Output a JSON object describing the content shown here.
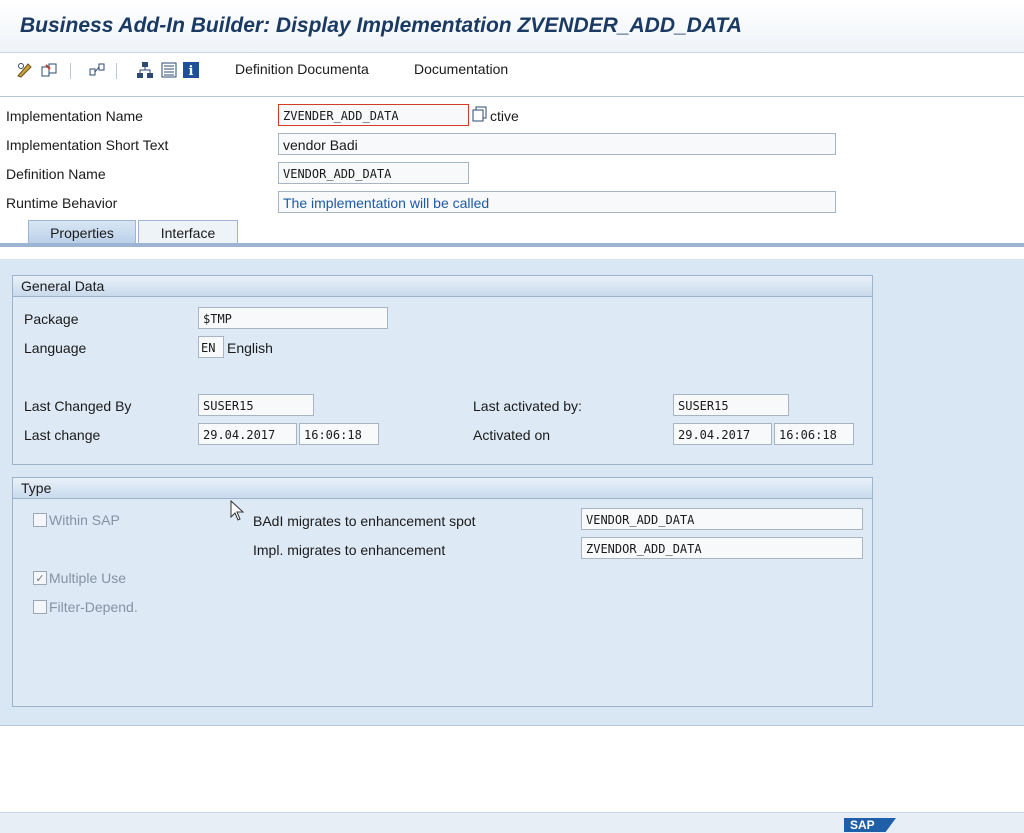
{
  "window": {
    "title": "Business Add-In Builder: Display Implementation ZVENDER_ADD_DATA"
  },
  "toolbar": {
    "icons": [
      "pencil-glasses-icon",
      "object-navigation-icon",
      "where-used-icon",
      "hierarchy-icon",
      "print-icon",
      "info-icon"
    ],
    "definition_doc_label": "Definition Documenta",
    "documentation_label": "Documentation"
  },
  "header": {
    "impl_name_label": "Implementation Name",
    "impl_name_value": "ZVENDER_ADD_DATA",
    "active_text": "ctive",
    "short_text_label": "Implementation Short Text",
    "short_text_value": "vendor Badi",
    "definition_label": "Definition Name",
    "definition_value": "VENDOR_ADD_DATA",
    "runtime_label": "Runtime Behavior",
    "runtime_value": "The implementation will be called"
  },
  "tabs": [
    {
      "label": "Properties",
      "active": true
    },
    {
      "label": "Interface",
      "active": false
    }
  ],
  "general": {
    "title": "General Data",
    "package_label": "Package",
    "package_value": "$TMP",
    "language_label": "Language",
    "language_code": "EN",
    "language_name": "English",
    "changed_by_label": "Last Changed By",
    "changed_by_value": "SUSER15",
    "last_change_label": "Last change",
    "last_change_date": "29.04.2017",
    "last_change_time": "16:06:18",
    "activated_by_label": "Last activated by:",
    "activated_by_value": "SUSER15",
    "activated_on_label": "Activated on",
    "activated_on_date": "29.04.2017",
    "activated_on_time": "16:06:18"
  },
  "type": {
    "title": "Type",
    "within_sap_label": "Within SAP",
    "within_sap_checked": false,
    "multiple_use_label": "Multiple Use",
    "multiple_use_checked": true,
    "filter_label": "Filter-Depend.",
    "filter_checked": false,
    "badi_migrates_label": "BAdI migrates to enhancement spot",
    "badi_migrates_value": "VENDOR_ADD_DATA",
    "impl_migrates_label": "Impl. migrates to enhancement",
    "impl_migrates_value": "ZVENDOR_ADD_DATA"
  },
  "status": {
    "logo_text": "SAP"
  },
  "colors": {
    "title": "#1b3a63",
    "accent_blue": "#1e5aa8",
    "panel_bg": "#d9e7f4"
  }
}
